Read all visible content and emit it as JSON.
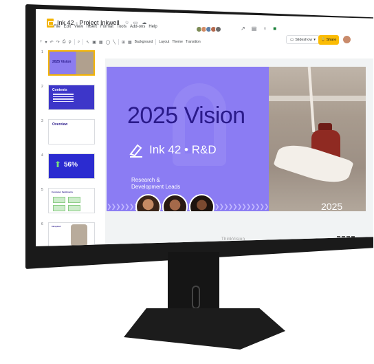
{
  "app": {
    "title": "Ink 42 - Project Inkwell",
    "menu": [
      "File",
      "Edit",
      "View",
      "Insert",
      "Format",
      "Tools",
      "Add-ons",
      "Help"
    ]
  },
  "toolbar": {
    "background_label": "Background",
    "layout_label": "Layout",
    "theme_label": "Theme",
    "transition_label": "Transition"
  },
  "actions": {
    "slideshow_label": "Slideshow",
    "share_label": "Share"
  },
  "filmstrip": {
    "slides": [
      {
        "number": "1",
        "text": "2025 Vision"
      },
      {
        "number": "2",
        "text": "Contents"
      },
      {
        "number": "3",
        "text": "Overview"
      },
      {
        "number": "4",
        "text": "56%"
      },
      {
        "number": "5",
        "text": "Customer Sentiments"
      },
      {
        "number": "6",
        "text": "Inkspired"
      }
    ]
  },
  "slide": {
    "title": "2025 Vision",
    "subtitle": "Ink 42 • R&D",
    "lead_text": "Research & Development Leads",
    "year": "2025"
  },
  "monitor": {
    "brand": "ThinkVision"
  },
  "colors": {
    "slide_purple": "#8b7cf3",
    "title_navy": "#2a1a8a",
    "share_yellow": "#fbbc04",
    "selected_border": "#f4b400"
  }
}
